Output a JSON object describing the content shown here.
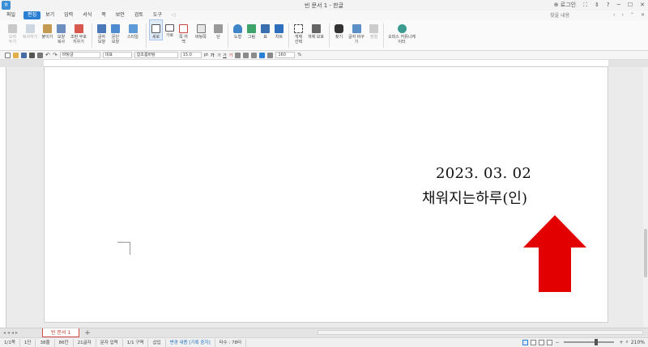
{
  "window": {
    "title": "빈 문서 1 - 한글",
    "login_label": "로그인",
    "help_label": "?"
  },
  "menu": {
    "file": "파일",
    "items": [
      "편집",
      "보기",
      "입력",
      "서식",
      "쪽",
      "보안",
      "검토",
      "도구"
    ],
    "active_index": 0,
    "search_placeholder": "찾을 내용"
  },
  "ribbon": {
    "groups": [
      [
        {
          "label": "오려 두기",
          "disabled": true,
          "icon": "scissors-icon"
        },
        {
          "label": "복사하기",
          "disabled": true,
          "icon": "copy-icon"
        },
        {
          "label": "붙이기",
          "icon": "paste-icon"
        },
        {
          "label": "모양 복사",
          "icon": "format-painter-icon"
        },
        {
          "label": "조판 부호 지우기",
          "icon": "clear-codes-icon"
        }
      ],
      [
        {
          "label": "글자 모양",
          "icon": "char-shape-icon"
        },
        {
          "label": "문단 모양",
          "icon": "para-shape-icon"
        },
        {
          "label": "스타일",
          "icon": "style-icon"
        }
      ],
      [
        {
          "label": "세로",
          "selected": true,
          "icon": "portrait-icon"
        },
        {
          "label": "가로",
          "icon": "landscape-icon"
        },
        {
          "label": "쪽 여백",
          "icon": "margin-icon"
        },
        {
          "label": "바탕쪽",
          "icon": "master-page-icon"
        },
        {
          "label": "단",
          "icon": "columns-icon"
        }
      ],
      [
        {
          "label": "도형",
          "icon": "shape-icon"
        },
        {
          "label": "그림",
          "icon": "picture-icon"
        },
        {
          "label": "표",
          "icon": "table-icon"
        },
        {
          "label": "차트",
          "icon": "chart-icon"
        }
      ],
      [
        {
          "label": "개체 선택",
          "icon": "object-select-icon"
        },
        {
          "label": "개체 보호",
          "icon": "object-protect-icon"
        }
      ],
      [
        {
          "label": "찾기",
          "icon": "find-icon"
        },
        {
          "label": "글자 바꾸기",
          "icon": "replace-icon"
        },
        {
          "label": "정렬",
          "disabled": true,
          "icon": "sort-icon"
        }
      ],
      [
        {
          "label": "오피스 커뮤니케이터",
          "icon": "messenger-icon"
        }
      ]
    ]
  },
  "format_bar": {
    "style": "바탕글",
    "lang": "대표",
    "font": "함초롬바탕",
    "size": "15.0",
    "unit": "pt",
    "zoom": "160",
    "zoom_unit": "%"
  },
  "document": {
    "date": "2023. 03. 02",
    "signature": "채워지는하루(인)"
  },
  "arrow": {
    "color": "#e30000",
    "direction": "up"
  },
  "tabs": {
    "doc_tab": "빈 문서 1",
    "add": "+"
  },
  "status": {
    "items": [
      "1/1쪽",
      "1단",
      "38줄",
      "86칸",
      "21글자",
      "문자 입력",
      "1/1 구역",
      "삽입"
    ],
    "track": "변경 내용 [기록 중지]",
    "extra": "타수 : 78타",
    "zoom": "210%"
  }
}
